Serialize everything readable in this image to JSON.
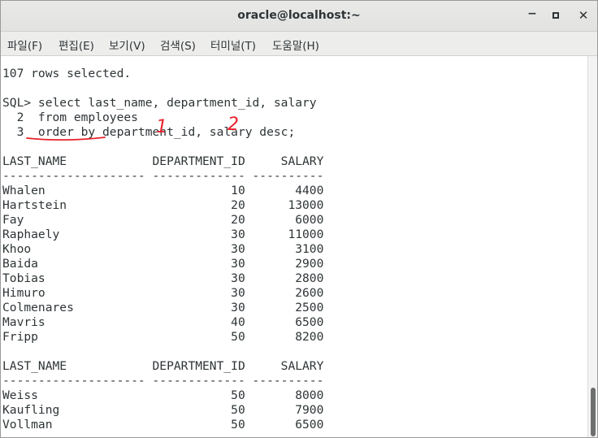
{
  "window": {
    "title": "oracle@localhost:~",
    "minimize": "−",
    "close": "✕"
  },
  "menu": [
    {
      "label": "파일(F)"
    },
    {
      "label": "편집(E)"
    },
    {
      "label": "보기(V)"
    },
    {
      "label": "검색(S)"
    },
    {
      "label": "터미널(T)"
    },
    {
      "label": "도움말(H)"
    }
  ],
  "terminal": {
    "lines": [
      "107 rows selected.",
      "",
      "SQL> select last_name, department_id, salary",
      "  2  from employees",
      "  3  order by department_id, salary desc;",
      "",
      "LAST_NAME            DEPARTMENT_ID     SALARY",
      "-------------------- ------------- ----------",
      "Whalen                          10       4400",
      "Hartstein                       20      13000",
      "Fay                             20       6000",
      "Raphaely                        30      11000",
      "Khoo                            30       3100",
      "Baida                           30       2900",
      "Tobias                          30       2800",
      "Himuro                          30       2600",
      "Colmenares                      30       2500",
      "Mavris                          40       6500",
      "Fripp                           50       8200",
      "",
      "LAST_NAME            DEPARTMENT_ID     SALARY",
      "-------------------- ------------- ----------",
      "Weiss                           50       8000",
      "Kaufling                        50       7900",
      "Vollman                         50       6500"
    ]
  },
  "annotations": {
    "mark_one": "1",
    "mark_two": "2",
    "color": "#e8202a"
  }
}
